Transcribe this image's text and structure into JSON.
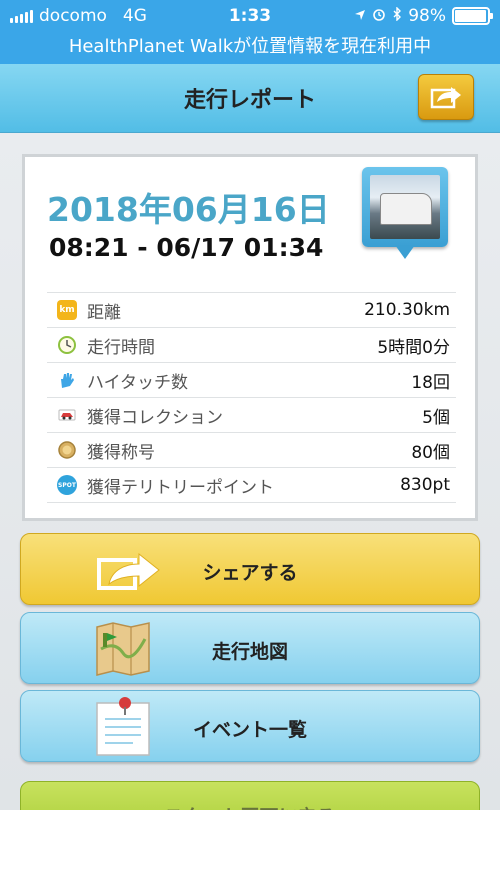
{
  "status_bar": {
    "carrier": "docomo",
    "network": "4G",
    "time": "1:33",
    "battery": "98%",
    "location_notice": "HealthPlanet Walkが位置情報を現在利用中"
  },
  "nav": {
    "title": "走行レポート"
  },
  "report": {
    "date": "2018年06月16日",
    "time_range": "08:21 - 06/17 01:34",
    "stats": [
      {
        "label": "距離",
        "value": "210.30km",
        "icon": "km-icon",
        "icon_text": "km",
        "color": "#f3b51a"
      },
      {
        "label": "走行時間",
        "value": "5時間0分",
        "icon": "clock-icon",
        "icon_text": "",
        "color": "#8dc13f"
      },
      {
        "label": "ハイタッチ数",
        "value": "18回",
        "icon": "hand-icon",
        "icon_text": "",
        "color": "#3fa6e6"
      },
      {
        "label": "獲得コレクション",
        "value": "5個",
        "icon": "car-icon",
        "icon_text": "",
        "color": "#d83c3c"
      },
      {
        "label": "獲得称号",
        "value": "80個",
        "icon": "medal-icon",
        "icon_text": "",
        "color": "#caa04a"
      },
      {
        "label": "獲得テリトリーポイント",
        "value": "830pt",
        "icon": "spot-icon",
        "icon_text": "SPOT",
        "color": "#2fa3dc"
      }
    ]
  },
  "buttons": {
    "share": "シェアする",
    "map": "走行地図",
    "events": "イベント一覧",
    "partial": "スタート画面に戻る"
  }
}
